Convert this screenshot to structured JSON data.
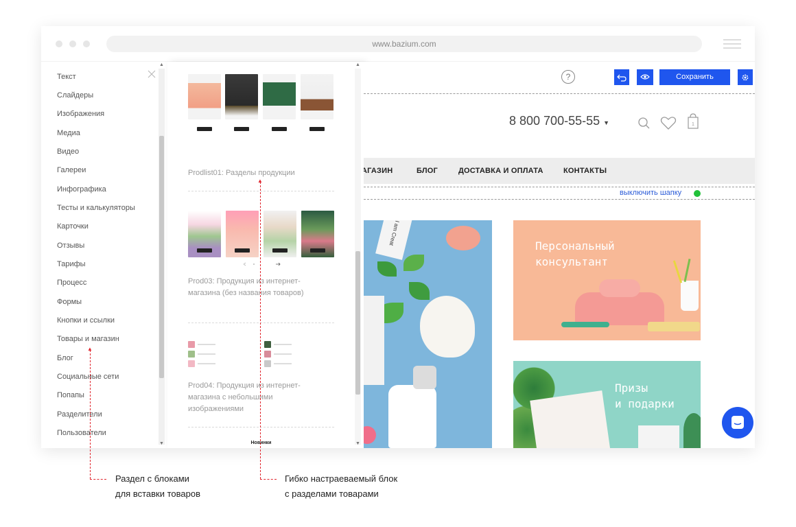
{
  "browser": {
    "url": "www.bazium.com"
  },
  "sidebar": {
    "categories": [
      "Текст",
      "Слайдеры",
      "Изображения",
      "Медиа",
      "Видео",
      "Галереи",
      "Инфографика",
      "Тесты и калькуляторы",
      "Карточки",
      "Отзывы",
      "Тарифы",
      "Процесс",
      "Формы",
      "Кнопки и ссылки",
      "Товары и магазин",
      "Блог",
      "Социальные сети",
      "Попапы",
      "Разделители",
      "Пользователи"
    ]
  },
  "blocks": [
    {
      "title": "Prodlist01: Разделы продукции"
    },
    {
      "title": "Prod03: Продукция из интернет-магазина (без названия товаров)"
    },
    {
      "title": "Prod04: Продукция из интернет-магазина с небольшими изображениями"
    },
    {
      "title": "Новинки"
    }
  ],
  "toolbar": {
    "help": "?",
    "save_label": "Сохранить"
  },
  "site": {
    "phone": "8 800 700-55-55",
    "nav": [
      "АГАЗИН",
      "БЛОГ",
      "ДОСТАВКА И ОПЛАТА",
      "КОНТАКТЫ"
    ],
    "header_toggle": "выключить шапку",
    "tiles": [
      {
        "line1": "Персональный",
        "line2": "консультант"
      },
      {
        "line1": "Призы",
        "line2": "и подарки"
      }
    ],
    "card_caption": "I am Creat"
  },
  "annotations": {
    "left": {
      "line1": "Раздел с блоками",
      "line2": "для вставки товаров"
    },
    "right": {
      "line1": "Гибко настраеваемый блок",
      "line2": "с разделами товарами"
    }
  },
  "colors": {
    "accent": "#1f56ee",
    "peach": "#f8b997",
    "teal": "#8fd5c7",
    "sky": "#7eb6dc",
    "annotation": "#e0242c",
    "toggle_on": "#22c13a"
  }
}
